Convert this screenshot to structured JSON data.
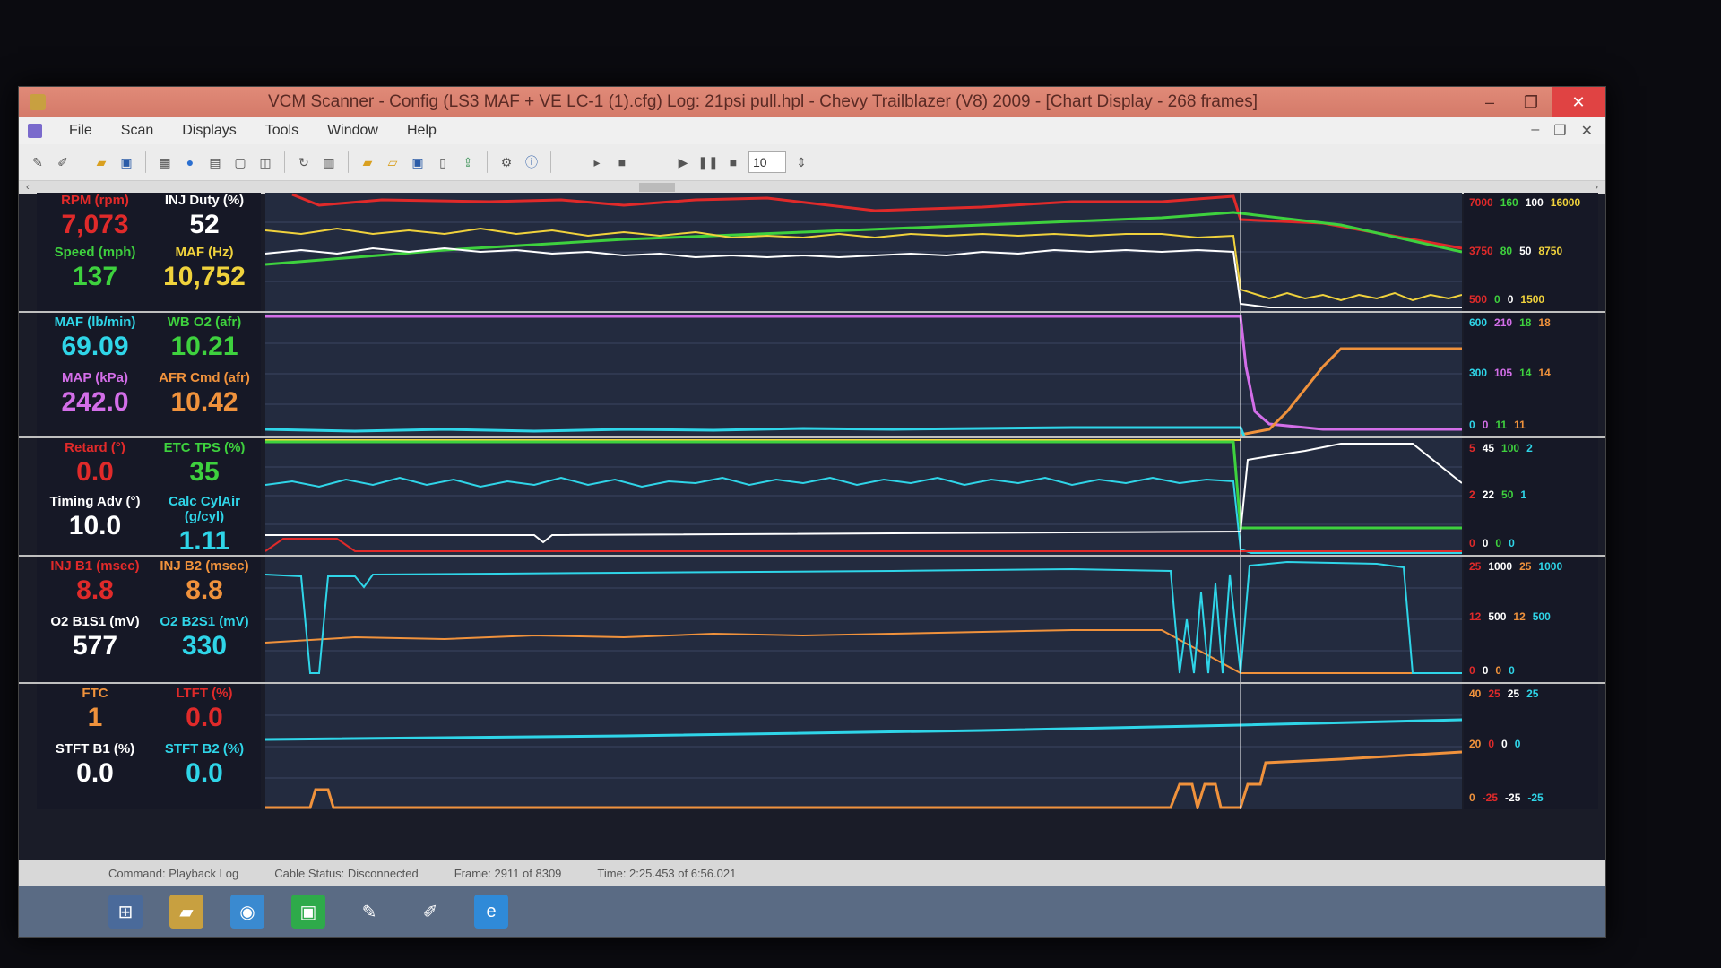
{
  "window": {
    "title": "VCM Scanner  -  Config  (LS3 MAF + VE LC-1 (1).cfg)   Log: 21psi pull.hpl  -  Chevy Trailblazer (V8) 2009 - [Chart Display  -  268 frames]",
    "controls": {
      "minimize": "–",
      "restore": "❐",
      "close": "✕"
    }
  },
  "menu": {
    "items": [
      "File",
      "Scan",
      "Displays",
      "Tools",
      "Window",
      "Help"
    ],
    "mdi_minimize": "–",
    "mdi_restore": "❐",
    "mdi_close": "✕"
  },
  "toolbar": {
    "frames_value": "10"
  },
  "panels": [
    {
      "cells": [
        {
          "label": "RPM (rpm)",
          "value": "7,073",
          "color": "#e02a2a"
        },
        {
          "label": "INJ Duty (%)",
          "value": "52",
          "color": "#ffffff"
        },
        {
          "label": "Speed (mph)",
          "value": "137",
          "color": "#3ed13e"
        },
        {
          "label": "MAF (Hz)",
          "value": "10,752",
          "color": "#f0d23c"
        }
      ],
      "scales": [
        [
          {
            "t": "7000",
            "c": "#e02a2a"
          },
          {
            "t": "160",
            "c": "#3ed13e"
          },
          {
            "t": "100",
            "c": "#ffffff"
          },
          {
            "t": "16000",
            "c": "#f0d23c"
          }
        ],
        [
          {
            "t": "3750",
            "c": "#e02a2a"
          },
          {
            "t": "80",
            "c": "#3ed13e"
          },
          {
            "t": "50",
            "c": "#ffffff"
          },
          {
            "t": "8750",
            "c": "#f0d23c"
          }
        ],
        [
          {
            "t": "500",
            "c": "#e02a2a"
          },
          {
            "t": "0",
            "c": "#3ed13e"
          },
          {
            "t": "0",
            "c": "#ffffff"
          },
          {
            "t": "1500",
            "c": "#f0d23c"
          }
        ]
      ]
    },
    {
      "cells": [
        {
          "label": "MAF (lb/min)",
          "value": "69.09",
          "color": "#2fd5e8"
        },
        {
          "label": "WB O2 (afr)",
          "value": "10.21",
          "color": "#3ed13e"
        },
        {
          "label": "MAP (kPa)",
          "value": "242.0",
          "color": "#d36ee8"
        },
        {
          "label": "AFR Cmd (afr)",
          "value": "10.42",
          "color": "#f0923c"
        }
      ],
      "scales": [
        [
          {
            "t": "600",
            "c": "#2fd5e8"
          },
          {
            "t": "210",
            "c": "#d36ee8"
          },
          {
            "t": "18",
            "c": "#3ed13e"
          },
          {
            "t": "18",
            "c": "#f0923c"
          }
        ],
        [
          {
            "t": "300",
            "c": "#2fd5e8"
          },
          {
            "t": "105",
            "c": "#d36ee8"
          },
          {
            "t": "14",
            "c": "#3ed13e"
          },
          {
            "t": "14",
            "c": "#f0923c"
          }
        ],
        [
          {
            "t": "0",
            "c": "#2fd5e8"
          },
          {
            "t": "0",
            "c": "#d36ee8"
          },
          {
            "t": "11",
            "c": "#3ed13e"
          },
          {
            "t": "11",
            "c": "#f0923c"
          }
        ]
      ]
    },
    {
      "cells": [
        {
          "label": "Retard (°)",
          "value": "0.0",
          "color": "#e02a2a"
        },
        {
          "label": "ETC TPS (%)",
          "value": "35",
          "color": "#3ed13e"
        },
        {
          "label": "Timing Adv (°)",
          "value": "10.0",
          "color": "#ffffff"
        },
        {
          "label": "Calc CylAir (g/cyl)",
          "value": "1.11",
          "color": "#2fd5e8"
        }
      ],
      "scales": [
        [
          {
            "t": "5",
            "c": "#e02a2a"
          },
          {
            "t": "45",
            "c": "#ffffff"
          },
          {
            "t": "100",
            "c": "#3ed13e"
          },
          {
            "t": "2",
            "c": "#2fd5e8"
          }
        ],
        [
          {
            "t": "2",
            "c": "#e02a2a"
          },
          {
            "t": "22",
            "c": "#ffffff"
          },
          {
            "t": "50",
            "c": "#3ed13e"
          },
          {
            "t": "1",
            "c": "#2fd5e8"
          }
        ],
        [
          {
            "t": "0",
            "c": "#e02a2a"
          },
          {
            "t": "0",
            "c": "#ffffff"
          },
          {
            "t": "0",
            "c": "#3ed13e"
          },
          {
            "t": "0",
            "c": "#2fd5e8"
          }
        ]
      ]
    },
    {
      "cells": [
        {
          "label": "INJ B1 (msec)",
          "value": "8.8",
          "color": "#e02a2a"
        },
        {
          "label": "INJ B2 (msec)",
          "value": "8.8",
          "color": "#f0923c"
        },
        {
          "label": "O2 B1S1 (mV)",
          "value": "577",
          "color": "#ffffff"
        },
        {
          "label": "O2 B2S1 (mV)",
          "value": "330",
          "color": "#2fd5e8"
        }
      ],
      "scales": [
        [
          {
            "t": "25",
            "c": "#e02a2a"
          },
          {
            "t": "1000",
            "c": "#ffffff"
          },
          {
            "t": "25",
            "c": "#f0923c"
          },
          {
            "t": "1000",
            "c": "#2fd5e8"
          }
        ],
        [
          {
            "t": "12",
            "c": "#e02a2a"
          },
          {
            "t": "500",
            "c": "#ffffff"
          },
          {
            "t": "12",
            "c": "#f0923c"
          },
          {
            "t": "500",
            "c": "#2fd5e8"
          }
        ],
        [
          {
            "t": "0",
            "c": "#e02a2a"
          },
          {
            "t": "0",
            "c": "#ffffff"
          },
          {
            "t": "0",
            "c": "#f0923c"
          },
          {
            "t": "0",
            "c": "#2fd5e8"
          }
        ]
      ]
    },
    {
      "cells": [
        {
          "label": "FTC",
          "value": "1",
          "color": "#f0923c"
        },
        {
          "label": "LTFT (%)",
          "value": "0.0",
          "color": "#e02a2a"
        },
        {
          "label": "STFT B1 (%)",
          "value": "0.0",
          "color": "#ffffff"
        },
        {
          "label": "STFT B2 (%)",
          "value": "0.0",
          "color": "#2fd5e8"
        }
      ],
      "scales": [
        [
          {
            "t": "40",
            "c": "#f0923c"
          },
          {
            "t": "25",
            "c": "#e02a2a"
          },
          {
            "t": "25",
            "c": "#ffffff"
          },
          {
            "t": "25",
            "c": "#2fd5e8"
          }
        ],
        [
          {
            "t": "20",
            "c": "#f0923c"
          },
          {
            "t": "0",
            "c": "#e02a2a"
          },
          {
            "t": "0",
            "c": "#ffffff"
          },
          {
            "t": "0",
            "c": "#2fd5e8"
          }
        ],
        [
          {
            "t": "0",
            "c": "#f0923c"
          },
          {
            "t": "-25",
            "c": "#e02a2a"
          },
          {
            "t": "-25",
            "c": "#ffffff"
          },
          {
            "t": "-25",
            "c": "#2fd5e8"
          }
        ]
      ]
    }
  ],
  "status": {
    "command": "Command: Playback Log",
    "cable": "Cable Status: Disconnected",
    "frame": "Frame: 2911 of 8309",
    "time": "Time: 2:25.453 of 6:56.021"
  }
}
